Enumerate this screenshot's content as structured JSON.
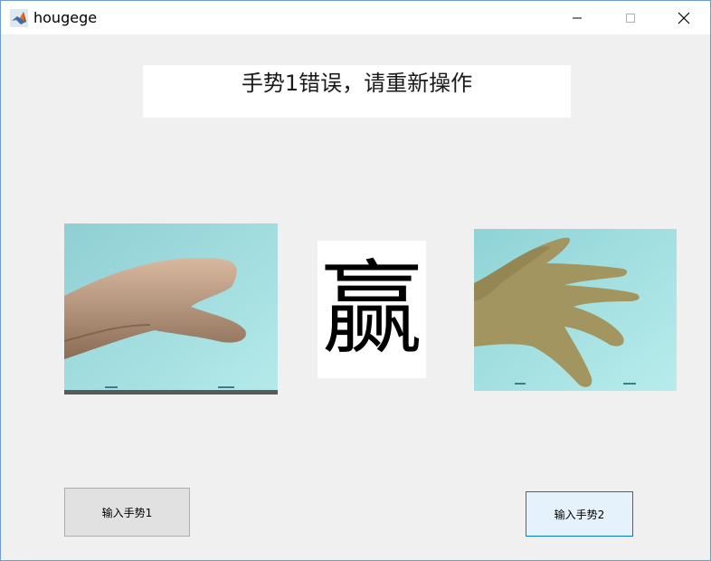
{
  "window": {
    "title": "hougege",
    "icon": "matlab-logo-icon",
    "controls": [
      "minimize-icon",
      "maximize-icon",
      "close-icon"
    ]
  },
  "status": {
    "message": "手势1错误，请重新操作"
  },
  "images": {
    "left": {
      "content": "hand-gesture-image-1"
    },
    "right": {
      "content": "hand-gesture-image-2"
    }
  },
  "result": {
    "text": "赢"
  },
  "buttons": {
    "input_gesture_1": "输入手势1",
    "input_gesture_2": "输入手势2"
  },
  "colors": {
    "window_bg": "#f0f0f0",
    "panel_bg": "#ffffff",
    "button_bg": "#e1e1e1",
    "focused_button_bg": "#e5f1fb",
    "focused_button_border": "#0078d7"
  }
}
